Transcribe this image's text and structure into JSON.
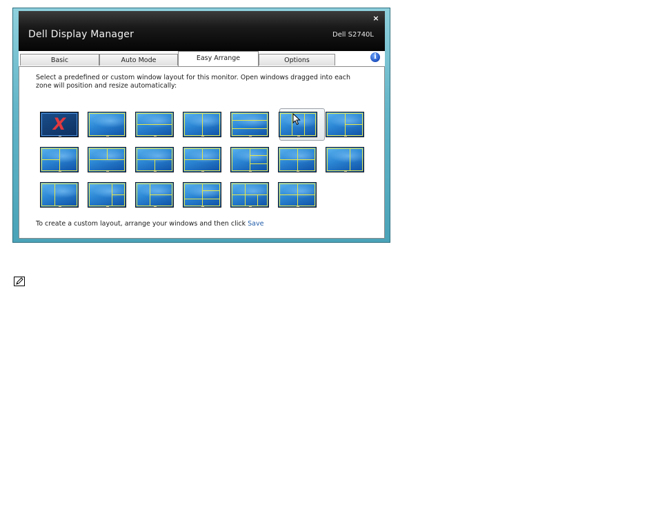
{
  "window": {
    "title": "Dell Display Manager",
    "model": "Dell S2740L",
    "close_symbol": "×"
  },
  "tabs": [
    {
      "label": "Basic",
      "active": false
    },
    {
      "label": "Auto Mode",
      "active": false
    },
    {
      "label": "Easy Arrange",
      "active": true
    },
    {
      "label": "Options",
      "active": false
    }
  ],
  "info_icon": {
    "symbol": "i",
    "icon": "info-icon"
  },
  "easy_arrange": {
    "instruction": "Select a predefined or custom window layout for this monitor. Open windows dragged into each zone will position and resize automatically:",
    "footer_text": "To create a custom layout, arrange your windows and then click ",
    "save_link": "Save",
    "selected_layout_index": 5,
    "layouts": [
      {
        "name": "none",
        "x_mark": "X"
      },
      {
        "name": "full"
      },
      {
        "name": "split-horizontal-2"
      },
      {
        "name": "split-vertical-2"
      },
      {
        "name": "split-horizontal-3"
      },
      {
        "name": "split-vertical-3"
      },
      {
        "name": "left-large-right-2"
      },
      {
        "name": "top-split-bottom-full"
      },
      {
        "name": "left-2-right-full"
      },
      {
        "name": "top-full-bottom-split"
      },
      {
        "name": "left-full-right-2"
      },
      {
        "name": "left-right-3"
      },
      {
        "name": "quad-unequal"
      },
      {
        "name": "left-narrow-right-wide"
      },
      {
        "name": "left-wide-right-narrow"
      },
      {
        "name": "right-wide-3"
      },
      {
        "name": "left-narrow-2-right"
      },
      {
        "name": "grid-6"
      },
      {
        "name": "grid-5"
      },
      {
        "name": "grid-4"
      }
    ]
  },
  "colors": {
    "frame": "#62b4c7",
    "titlebar": "#0a0a0a",
    "zone_line": "#e8e84a",
    "link": "#1e5aa8",
    "blank_x": "#e0393f"
  }
}
